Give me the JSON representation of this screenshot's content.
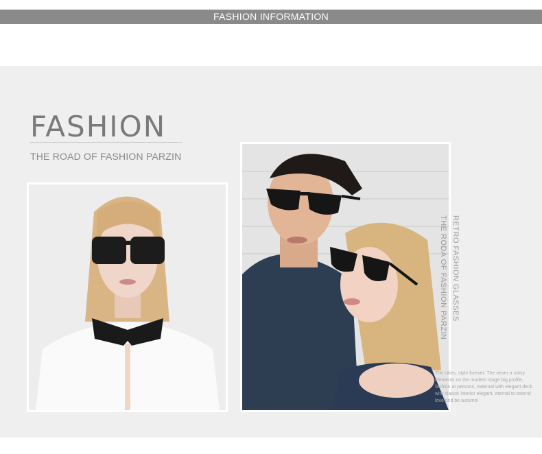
{
  "banner": {
    "title": "FASHION INFORMATION",
    "background_color": "#8a8a8a"
  },
  "brand": {
    "title": "FASHION",
    "subtitle": "THE ROAD OF FASHION PARZIN"
  },
  "side_text": {
    "line1": "RETRO FASHION GLASSES",
    "line2": "THE RODA OF FASHION PARZIN"
  },
  "blurb": "The cities, style forever. The never a noisy elements on the modern stage big profile, fashion at persons, external with elegant deck with classic interior elegant, eternal to extend love and be autumn!",
  "colors": {
    "panel": "#efefef",
    "title_text": "#7a7a7a",
    "subtitle_text": "#888888"
  }
}
